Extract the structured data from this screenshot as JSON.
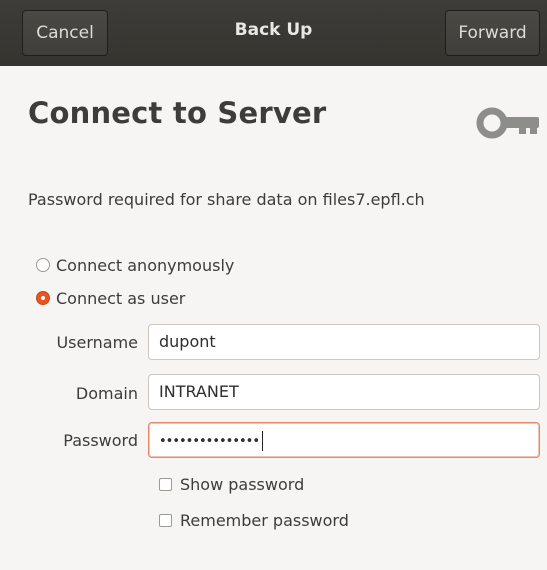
{
  "headerbar": {
    "cancel_label": "Cancel",
    "title": "Back Up",
    "forward_label": "Forward"
  },
  "page": {
    "title": "Connect to Server",
    "icon": "key-icon",
    "description": "Password required for share data on files7.epfl.ch"
  },
  "connect_options": [
    {
      "label": "Connect anonymously",
      "selected": false
    },
    {
      "label": "Connect as user",
      "selected": true
    }
  ],
  "fields": {
    "username": {
      "label": "Username",
      "value": "dupont"
    },
    "domain": {
      "label": "Domain",
      "value": "INTRANET"
    },
    "password": {
      "label": "Password",
      "masked_value": "•••••••••••••••"
    }
  },
  "checkboxes": [
    {
      "label": "Show password",
      "checked": false
    },
    {
      "label": "Remember password",
      "checked": false
    }
  ],
  "colors": {
    "accent": "#e95420",
    "headerbar": "#3b3a36",
    "background": "#f6f5f4"
  }
}
